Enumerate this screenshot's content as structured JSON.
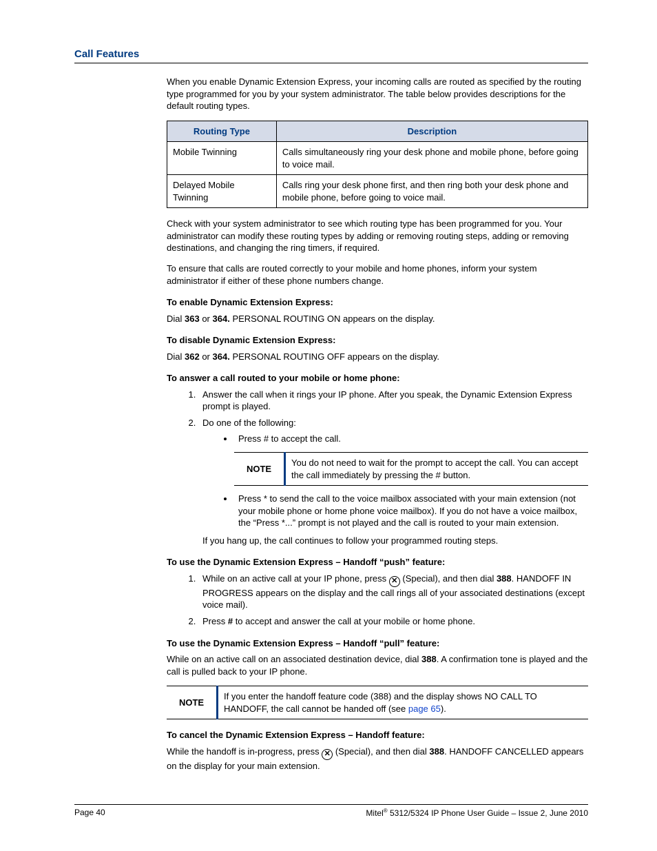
{
  "header": {
    "title": "Call Features"
  },
  "intro": "When you enable Dynamic Extension Express, your incoming calls are routed as specified by the routing type programmed for you by your system administrator. The table below provides descriptions for the default routing types.",
  "routing_table": {
    "headers": {
      "type": "Routing Type",
      "desc": "Description"
    },
    "rows": [
      {
        "type": "Mobile Twinning",
        "desc": "Calls simultaneously ring your desk phone and mobile phone, before going to voice mail."
      },
      {
        "type": "Delayed Mobile Twinning",
        "desc": "Calls ring your desk phone first, and then ring both your desk phone and mobile phone, before going to voice mail."
      }
    ]
  },
  "para_check": "Check with your system administrator to see which routing type has been programmed for you. Your administrator can modify these routing types by adding or removing routing steps, adding or removing destinations, and changing the ring timers, if required.",
  "para_ensure": "To ensure that calls are routed correctly to your mobile and home phones, inform your system administrator if either of these phone numbers change.",
  "enable": {
    "heading": "To enable Dynamic Extension Express:",
    "dial_pre": "Dial ",
    "c1": "363",
    "or": " or ",
    "c2": "364.",
    "tail": " PERSONAL ROUTING ON appears on the display."
  },
  "disable": {
    "heading": "To disable Dynamic Extension Express:",
    "dial_pre": "Dial ",
    "c1": "362",
    "or": " or ",
    "c2": "364.",
    "tail": " PERSONAL ROUTING OFF appears on the display."
  },
  "answer": {
    "heading": "To answer a call routed to your mobile or home phone:",
    "step1": "Answer the call when it rings your IP phone. After you speak, the Dynamic Extension Express prompt is played.",
    "step2": "Do one of the following:",
    "bullet_hash": "Press # to accept the call.",
    "note_label": "NOTE",
    "note_text": "You do not need to wait for the prompt to accept the call. You can accept the call immediately by pressing the # button.",
    "bullet_star": "Press * to send the call to the voice mailbox associated with your main extension (not your mobile phone or home phone voice mailbox). If you do not have a voice mailbox, the “Press *...” prompt is not played and the call is routed to your main extension.",
    "hangup": "If you hang up, the call continues to follow your programmed routing steps."
  },
  "push": {
    "heading": "To use the Dynamic Extension Express – Handoff “push” feature:",
    "s1a": "While on an active call at your IP phone, press ",
    "s1b": " (Special), and then dial ",
    "s1c": "388",
    "s1d": ". HANDOFF IN PROGRESS appears on the display and the call rings all of your associated destinations (except voice mail).",
    "s2a": "Press ",
    "s2b": "#",
    "s2c": " to accept and answer the call at your mobile or home phone."
  },
  "pull": {
    "heading": "To use the Dynamic Extension Express – Handoff “pull” feature:",
    "p1a": "While on an active call on an associated destination device, dial ",
    "p1b": "388",
    "p1c": ". A confirmation tone is played and the call is pulled back to your IP phone.",
    "note_label": "NOTE",
    "note_a": "If you enter the handoff feature code (388) and the display shows NO CALL TO HANDOFF, the call cannot be handed off (see ",
    "note_link": "page 65",
    "note_b": ")."
  },
  "cancel": {
    "heading": "To cancel the Dynamic Extension Express – Handoff feature:",
    "a": "While the handoff is in-progress, press ",
    "b": " (Special), and then dial ",
    "c": "388",
    "d": ". HANDOFF CANCELLED appears on the display for your main extension."
  },
  "special_glyph": "✕",
  "footer": {
    "page": "Page 40",
    "right_a": "Mitel",
    "right_b": " 5312/5324 IP Phone User Guide  –  Issue 2, June 2010",
    "reg": "®"
  }
}
